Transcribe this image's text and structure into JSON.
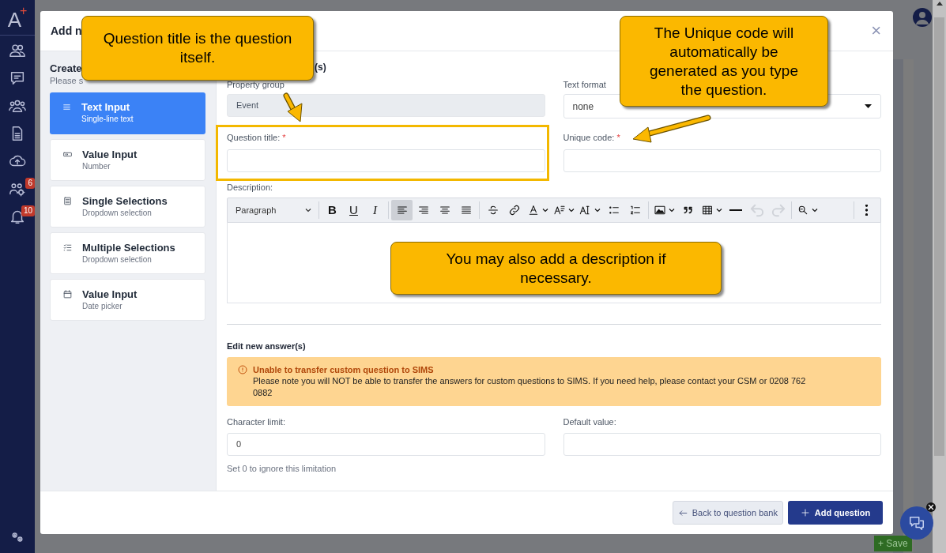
{
  "app_sidebar": {
    "logo": "A",
    "logo_mark": "+",
    "badges": [
      "6",
      "10"
    ]
  },
  "background": {
    "save_button": "+ Save"
  },
  "modal": {
    "title": "Add n",
    "close": "×",
    "types_panel": {
      "title": "Create",
      "subtitle": "Please s",
      "items": [
        {
          "label": "Text Input",
          "sublabel": "Single-line text",
          "selected": true
        },
        {
          "label": "Value Input",
          "sublabel": "Number",
          "selected": false
        },
        {
          "label": "Single Selections",
          "sublabel": "Dropdown selection",
          "selected": false
        },
        {
          "label": "Multiple Selections",
          "sublabel": "Dropdown selection",
          "selected": false
        },
        {
          "label": "Value Input",
          "sublabel": "Date picker",
          "selected": false
        }
      ]
    },
    "question_section": {
      "title": "(s)",
      "property_group": {
        "label": "Property group",
        "value": "Event",
        "disabled": true
      },
      "text_format": {
        "label": "Text format",
        "value": "none"
      },
      "question_title": {
        "label": "Question title:",
        "required": "*"
      },
      "unique_code": {
        "label": "Unique code:",
        "required": "*"
      },
      "description": {
        "label": "Description:",
        "block_format": "Paragraph",
        "toolbar": [
          {
            "glyph": "B",
            "selected": false,
            "disabled": false
          },
          {
            "glyph": "U",
            "selected": false,
            "disabled": false
          },
          {
            "glyph": "I",
            "selected": false,
            "disabled": false
          },
          {
            "selected": true,
            "disabled": false
          },
          {
            "selected": false,
            "disabled": false
          },
          {
            "selected": false,
            "disabled": false
          },
          {
            "selected": false,
            "disabled": false
          },
          {
            "selected": false,
            "disabled": false
          },
          {
            "selected": false,
            "disabled": false
          },
          {
            "selected": false,
            "disabled": false
          },
          {
            "selected": false,
            "disabled": false
          },
          {
            "selected": false,
            "disabled": false
          },
          {
            "selected": false,
            "disabled": false
          },
          {
            "selected": false,
            "disabled": false
          },
          {
            "selected": false,
            "disabled": false
          },
          {
            "selected": false,
            "disabled": false
          },
          {
            "selected": false,
            "disabled": false
          },
          {
            "selected": false,
            "disabled": false
          },
          {
            "selected": false,
            "disabled": true
          },
          {
            "selected": false,
            "disabled": true
          },
          {
            "selected": false,
            "disabled": false
          },
          {
            "selected": false,
            "disabled": false
          }
        ]
      }
    },
    "answer_section": {
      "title": "Edit new answer(s)",
      "alert": {
        "title": "Unable to transfer custom question to SIMS",
        "text": "Please note you will NOT be able to transfer the answers for custom questions to SIMS. If you need help, please contact your CSM or 0208 762 0882"
      },
      "character_limit": {
        "label": "Character limit:",
        "value": "0",
        "help": "Set 0 to ignore this limitation"
      },
      "default_value": {
        "label": "Default value:"
      }
    },
    "footer": {
      "back_button": "Back to question bank",
      "add_button": "Add question"
    }
  },
  "callouts": [
    {
      "text": "Question title is the question itself."
    },
    {
      "text": "The Unique code will automatically be generated as you type the question."
    },
    {
      "text": "You may also add a description if necessary."
    }
  ]
}
